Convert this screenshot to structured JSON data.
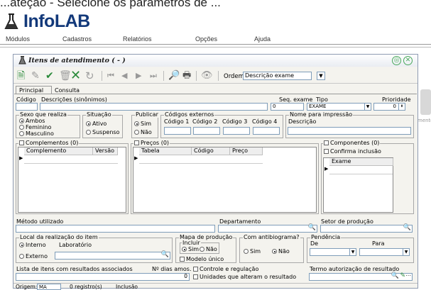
{
  "top_title": "...ateção - Selecione os parâmetros de ...",
  "app": {
    "name": "InfoLAB"
  },
  "menu": [
    "Módulos",
    "Cadastros",
    "Relatórios",
    "Opções",
    "Ajuda"
  ],
  "window": {
    "title": "Itens de atendimento ( - )"
  },
  "toolbar": {
    "order_label": "Ordem:",
    "order_value": "Descrição exame"
  },
  "tabs": [
    "Principal",
    "Consulta"
  ],
  "fields": {
    "codigo": "Código",
    "descricoes": "Descrições (sinônimos)",
    "seq_exame": "Seq. exame",
    "seq_exame_value": "0",
    "tipo": "Tipo",
    "tipo_value": "EXAME",
    "prioridade": "Prioridade",
    "prioridade_value": "0"
  },
  "sexo": {
    "title": "Sexo que realiza",
    "options": [
      "Ambos",
      "Feminino",
      "Masculino"
    ]
  },
  "situacao": {
    "title": "Situação",
    "options": [
      "Ativo",
      "Suspenso"
    ]
  },
  "publicar": {
    "title": "Publicar",
    "options": [
      "Sim",
      "Não"
    ]
  },
  "codigos_externos": {
    "title": "Códigos externos",
    "labels": [
      "Código 1",
      "Código 2",
      "Código 3",
      "Código 4"
    ]
  },
  "nome_impressao": {
    "title": "Nome para impressão",
    "label": "Descrição"
  },
  "complementos": {
    "title": "Complementos (0)",
    "columns": [
      "Complemento",
      "Versão"
    ]
  },
  "precos": {
    "title": "Preços (0)",
    "columns": [
      "Tabela",
      "Código",
      "Preço"
    ]
  },
  "componentes": {
    "title": "Componentes (0)",
    "confirm": "Confirma inclusão",
    "column": "Exame"
  },
  "side_text": "mento",
  "lower": {
    "metodo": "Método utilizado",
    "departamento": "Departamento",
    "setor": "Setor de produção",
    "local_title": "Local da realização do item",
    "local_interno": "Interno",
    "local_lab": "Laboratório",
    "local_externo": "Externo",
    "mapa_title": "Mapa de produção",
    "incluir": "Incluir",
    "sim": "Sim",
    "nao": "Não",
    "modelo_unico": "Modelo único",
    "antibiograma_title": "Com antibiograma?",
    "pendencia_title": "Pendência",
    "de": "De",
    "para": "Para",
    "lista_label": "Lista de itens com resultados associados",
    "n_dias": "Nº dias amos.",
    "n_dias_value": "0",
    "controle": "Controle e regulação",
    "unidades": "Unidades que alteram o resultado",
    "termo": "Termo autorização de resultado"
  },
  "status": {
    "origem_label": "Origem:",
    "origem_value": "MA",
    "registros": "0 registro(s)",
    "inclusao": "Inclusão"
  }
}
